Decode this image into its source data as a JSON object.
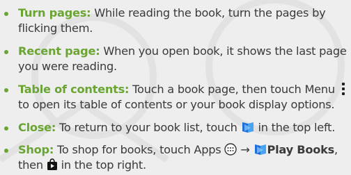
{
  "items": [
    {
      "term": "Turn pages:",
      "line1": "While reading the book, turn the pages by",
      "line2": "flicking them."
    },
    {
      "term": "Recent page:",
      "line1": "When you open book, it shows the last page",
      "line2": "you were reading."
    },
    {
      "term": "Table of contents:",
      "line1": "Touch a book page, then touch Menu",
      "line2": "to open its table of contents or your book display options."
    },
    {
      "term": "Close:",
      "line1a": "To return to your book list, touch",
      "line1b": "in the top left."
    },
    {
      "term": "Shop:",
      "line1a": "To shop for books, touch Apps",
      "arrow": "→",
      "app_name": "Play Books",
      "comma": ",",
      "line2a": "then",
      "line2b": "in the top right."
    }
  ],
  "colors": {
    "accent": "#6aa533",
    "text": "#3a3a3a",
    "background": "#eeeeee"
  },
  "icons": [
    "menu-icon",
    "play-books-icon",
    "apps-icon",
    "shop-icon"
  ]
}
